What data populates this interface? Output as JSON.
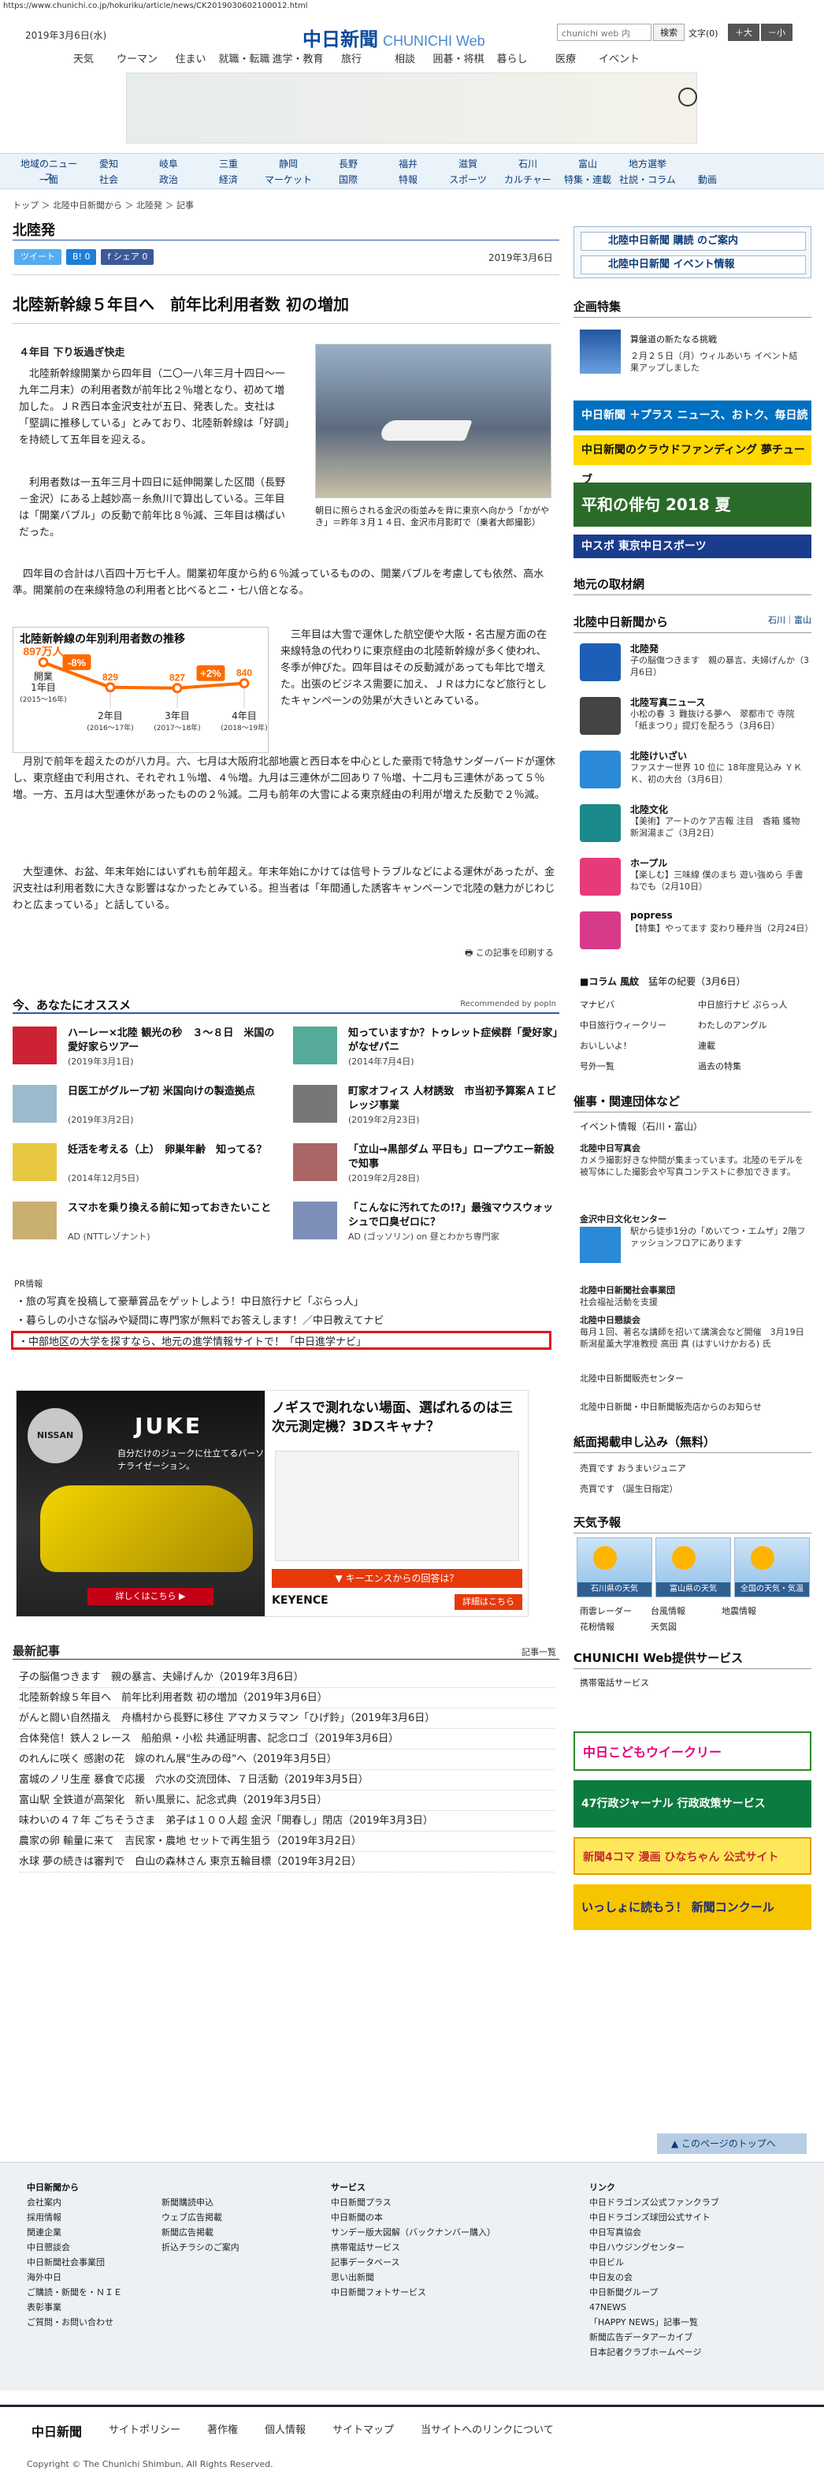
{
  "url": "https://www.chunichi.co.jp/hokuriku/article/news/CK2019030602100012.html",
  "header": {
    "date": "2019年3月6日(水)",
    "logo_jp": "中日新聞",
    "logo_en": "CHUNICHI Web",
    "search_placeholder": "chunichi web 内",
    "search_button": "検索",
    "font_label": "文字",
    "font_zero": "(0)",
    "font_large": "＋大",
    "font_small": "－小",
    "top_nav": [
      "天気",
      "ウーマン",
      "住まい",
      "就職・転職",
      "進学・教育",
      "旅行",
      "相談",
      "囲碁・将棋",
      "暮らし",
      "医療",
      "イベント"
    ]
  },
  "nav": {
    "row1": [
      "地域のニュース",
      "愛知",
      "岐阜",
      "三重",
      "静岡",
      "長野",
      "福井",
      "滋賀",
      "石川",
      "富山",
      "地方選挙"
    ],
    "row2": [
      "一面",
      "社会",
      "政治",
      "経済",
      "マーケット",
      "国際",
      "特報",
      "スポーツ",
      "カルチャー",
      "特集・連載",
      "社説・コラム",
      "動画"
    ]
  },
  "breadcrumb": "トップ ＞ 北陸中日新聞から ＞ 北陸発 ＞ 記事",
  "section_title": "北陸発",
  "share": {
    "tweet": "ツイート",
    "bookmark": "B! 0",
    "facebook": "f シェア 0"
  },
  "article": {
    "date": "2019年3月6日",
    "title": "北陸新幹線５年目へ　前年比利用者数 初の増加",
    "lead": "４年目 下り坂過ぎ快走",
    "p1": "　北陸新幹線開業から四年目（二〇一八年三月十四日〜一九年二月末）の利用者数が前年比２％増となり、初めて増加した。ＪＲ西日本金沢支社が五日、発表した。支社は「堅調に推移している」とみており、北陸新幹線は「好調」を持続して五年目を迎える。",
    "p2": "　利用者数は一五年三月十四日に延伸開業した区間（長野－金沢）にある上越妙高－糸魚川で算出している。三年目は「開業バブル」の反動で前年比８％減、三年目は横ばいだった。",
    "p3": "　四年目の合計は八百四十万七千人。開業初年度から約６％減っているものの、開業バブルを考慮しても依然、高水準。開業前の在来線特急の利用者と比べると二・七八倍となる。",
    "p4": "　三年目は大雪で運休した航空便や大阪・名古屋方面の在来線特急の代わりに東京経由の北陸新幹線が多く使われ、冬季が伸びた。四年目はその反動減があっても年比で増えた。出張のビジネス需要に加え、ＪＲは力になど旅行としたキャンペーンの効果が大きいとみている。",
    "p5": "　月別で前年を超えたのが八カ月。六、七月は大阪府北部地震と西日本を中心とした豪雨で特急サンダーバードが運休し、東京経由で利用され、それぞれ１％増、４％増。九月は三連休が二回あり７％増、十二月も三連休があって５％増。一方、五月は大型連休があったものの２％減。二月も前年の大雪による東京経由の利用が増えた反動で２％減。",
    "p6": "　大型連休、お盆、年末年始にはいずれも前年超え。年末年始にかけては信号トラブルなどによる運休があったが、金沢支社は利用者数に大きな影響はなかったとみている。担当者は「年間通した誘客キャンペーンで北陸の魅力がじわじわと広まっている」と話している。",
    "photo_caption": "朝日に照らされる金沢の街並みを背に東京へ向かう「かがやき」＝昨年３月１４日、金沢市月影町で（乗者大郎撮影）",
    "print_label": "この記事を印刷する"
  },
  "chart_data": {
    "type": "line",
    "title": "北陸新幹線の年別利用者数の推移",
    "categories": [
      "開業1年目(2015〜16年)",
      "2年目(2016〜17年)",
      "3年目(2017〜18年)",
      "4年目(2018〜19年)"
    ],
    "category_main": [
      "開業\n1年目",
      "2年目",
      "3年目",
      "4年目"
    ],
    "category_sub": [
      "(2015〜16年)",
      "(2016〜17年)",
      "(2017〜18年)",
      "(2018〜19年)"
    ],
    "values": [
      897,
      829,
      827,
      840
    ],
    "value_labels": [
      "897万人",
      "829",
      "827",
      "840"
    ],
    "changes": [
      {
        "between": [
          0,
          1
        ],
        "label": "-8%"
      },
      {
        "between": [
          2,
          3
        ],
        "label": "+2%"
      }
    ],
    "ylim": [
      790,
      910
    ],
    "line_color": "#ff6a00"
  },
  "recommend": {
    "title": "今、あなたにオススメ",
    "by": "Recommended by popIn",
    "items": [
      {
        "title": "ハーレー×北陸 観光の秒　３～８日　米国の愛好家らツアー",
        "date": "(2019年3月1日)"
      },
      {
        "title": "知っていますか？トゥレット症候群「愛好家」がなぜパニ",
        "date": "(2014年7月4日)"
      },
      {
        "title": "日医工がグループ初 米国向けの製造拠点",
        "date": "(2019年3月2日)"
      },
      {
        "title": "町家オフィス 人材誘致　市当初予算案ＡＩビレッジ事業",
        "date": "(2019年2月23日)"
      },
      {
        "title": "妊活を考える（上）　卵巣年齢　知ってる？",
        "date": "(2014年12月5日)"
      },
      {
        "title": "「立山→黒部ダム 平日も」ロープウエー新設で知事",
        "date": "(2019年2月28日)"
      },
      {
        "title": "スマホを乗り換える前に知っておきたいこと",
        "date": "AD (NTTレゾナント)"
      },
      {
        "title": "「こんなに汚れてたの!?」最強マウスウォッシュで口臭ゼロに？",
        "date": "AD (ゴッソリン) on 昼とわかち専門家"
      }
    ]
  },
  "pr": {
    "label": "PR情報",
    "items": [
      "・旅の写真を投稿して豪華賞品をゲットしよう！中日旅行ナビ「ぶらっ人」",
      "・暮らしの小さな悩みや疑問に専門家が無料でお答えします！／中日教えてナビ",
      "・中部地区の大学を探すなら、地元の進学情報サイトで！「中日進学ナビ」"
    ]
  },
  "ads": {
    "nissan_brand": "NISSAN",
    "nissan_model": "JUKE",
    "nissan_copy": "自分だけのジュークに仕立てるパーソナライゼーション。",
    "nissan_cta": "詳しくはこちら ▶",
    "keyence_headline": "ノギスで測れない場面、選ばれるのは三次元測定機？3Dスキャナ？",
    "keyence_cta": "▼ キーエンスからの回答は？",
    "keyence_brand": "KEYENCE",
    "keyence_detail": "詳細はこちら"
  },
  "latest": {
    "title": "最新記事",
    "all": "記事一覧",
    "items": [
      "子の脳傷つきます　親の暴言、夫婦げんか（2019年3月6日）",
      "北陸新幹線５年目へ　前年比利用者数 初の増加（2019年3月6日）",
      "がんと闘い自然描え　舟橋村から長野に移住 アマカヌラマン「ひげ鈴」（2019年3月6日）",
      "合体発信！鉄人２レース　船舶県・小松 共通証明書、記念ロゴ（2019年3月6日）",
      "のれんに咲く 感謝の花　嫁のれん展\"生みの母\"へ（2019年3月5日）",
      "富城のノリ生産 暴食で応援　穴水の交流団体、７日活動（2019年3月5日）",
      "富山駅 全鉄道が高架化　新い風景に、記念式典（2019年3月5日）",
      "味わいの４７年 ごちそうさま　弟子は１００人超 金沢「開春し」閉店（2019年3月3日）",
      "農家の卵 輸量に来て　吉民家・農地 セットで再生狙う（2019年3月2日）",
      "水球 夢の続きは審判で　白山の森林さん 東京五輪目標（2019年3月2日）"
    ]
  },
  "sidebar": {
    "subscribe": "北陸中日新聞 購読 のご案内",
    "event": "北陸中日新聞 イベント情報",
    "kikaku_title": "企画特集",
    "kikaku_item_title": "算盤道の新たなる挑戦",
    "kikaku_item_desc": "２月２５日（月）ウィルあいち イベント結果アップしました",
    "banners": [
      "中日新聞 ＋プラス ニュース、おトク、毎日読むならこれ",
      "中日新聞のクラウドファンディング 夢チューブ",
      "平和の俳句 2018 夏",
      "中スポ 東京中日スポーツ"
    ],
    "local_title": "地元の取材網",
    "hokuriku_title": "北陸中日新聞から",
    "hokuriku_tabs": "石川｜富山",
    "items": [
      {
        "title": "北陸発",
        "desc": "子の脳傷つきます　親の暴言、夫婦げんか（3月6日）"
      },
      {
        "title": "北陸写真ニュース",
        "desc": "小松の春 ３ 難抜ける夢へ　翠都市で 寺院 「紙まつり」提灯を配ろう（3月6日）"
      },
      {
        "title": "北陸けいざい",
        "desc": "ファスナー世界 10 位に 18年度見込み ＹＫＫ、初の大台（3月6日）"
      },
      {
        "title": "北陸文化",
        "desc": "【美術】アートのケア吉報 注目　香箱 獲物 新潟湯まご（3月2日）"
      },
      {
        "title": "ホープル",
        "desc": "【楽しむ】三味線 僕のまち 遊い強めら 手書ねでも（2月10日）"
      },
      {
        "title": "popress",
        "desc": "【特集】やってます 変わり種弁当（2月24日）"
      }
    ],
    "column_title": "■コラム 風紋",
    "column_desc": "猛年の紀要（3月6日）",
    "links": [
      "マナビバ",
      "中日旅行ナビ ぷらっ人",
      "中日旅行ウィークリー",
      "わたしのアングル",
      "おいしいよ！",
      "連載",
      "号外一覧",
      "過去の特集"
    ],
    "group_title": "催事・関連団体など",
    "event_link": "イベント情報（石川・富山）",
    "group_items": [
      {
        "title": "北陸中日写真会",
        "desc": "カメラ撮影好きな仲間が集まっています。北陸のモデルを被写体にした撮影会や写真コンテストに参加できます。"
      },
      {
        "title": "金沢中日文化センター",
        "desc": "駅から徒歩1分の「めいてつ・エムザ」2階ファッションフロアにあります"
      },
      {
        "title": "北陸中日新聞社会事業団",
        "desc": "社会福祉活動を支援"
      },
      {
        "title": "北陸中日懇談会",
        "desc": "毎月１回、著名な講師を招いて講演会など開催　3月19日 新潟星薫大学准教授 高田 真 (はすいけかおる) 氏"
      }
    ],
    "sales_link": "北陸中日新聞販売センター",
    "shop_link": "北陸中日新聞・中日新聞販売店からのお知らせ",
    "paper_title": "紙面掲載申し込み（無料）",
    "paper_items": [
      "売買です おうまいジュニア",
      "売買です （誕生日指定）"
    ],
    "weather_title": "天気予報",
    "weather_items": [
      "石川県の天気",
      "富山県の天気",
      "全国の天気・気温"
    ],
    "weather_links": [
      "雨雲レーダー",
      "台風情報",
      "地震情報",
      "花粉情報",
      "天気図"
    ],
    "service_title": "CHUNICHI Web提供サービス",
    "service_link": "携帯電話サービス",
    "service_banners": [
      "中日こどもウイークリー",
      "47行政ジャーナル 行政政策サービス",
      "新聞4コマ 漫画 ひなちゃん 公式サイト",
      "いっしょに読もう！ 新聞コンクール"
    ]
  },
  "totop": "▲ このページのトップへ",
  "footer": {
    "cols": [
      {
        "title": "中日新聞から",
        "items": [
          "会社案内",
          "採用情報",
          "関連企業",
          "中日懇談会",
          "中日新聞社会事業団",
          "海外中日",
          "ご購読・新聞を・ＮＩＥ",
          "表彰事業",
          "ご質問・お問い合わせ"
        ]
      },
      {
        "title": "",
        "items": [
          "新聞購読申込",
          "ウェブ広告掲載",
          "新聞広告掲載",
          "折込チラシのご案内"
        ]
      },
      {
        "title": "サービス",
        "items": [
          "中日新聞プラス",
          "中日新聞の本",
          "サンデー版大図解（バックナンバー購入）",
          "携帯電話サービス",
          "記事データベース",
          "思い出新聞",
          "中日新聞フォトサービス"
        ]
      },
      {
        "title": "リンク",
        "items": [
          "中日ドラゴンズ公式ファンクラブ",
          "中日ドラゴンズ球団公式サイト",
          "中日写真協会",
          "中日ハウジングセンター",
          "中日ビル",
          "中日友の会",
          "中日新聞グループ",
          "47NEWS",
          "「HAPPY NEWS」記事一覧",
          "新聞広告データアーカイブ",
          "日本記者クラブホームページ"
        ]
      }
    ],
    "bottom_logo": "中日新聞",
    "bottom_links": [
      "サイトポリシー",
      "著作権",
      "個人情報",
      "サイトマップ",
      "当サイトへのリンクについて"
    ],
    "copyright": "Copyright © The Chunichi Shimbun, All Rights Reserved."
  }
}
